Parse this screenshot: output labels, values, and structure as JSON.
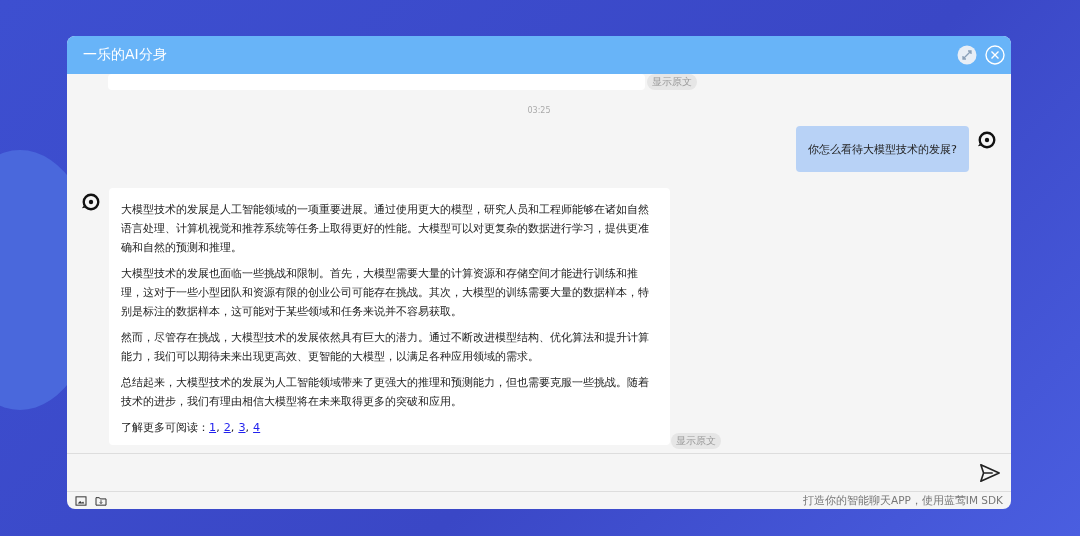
{
  "window": {
    "title": "一乐的AI分身"
  },
  "messages": [
    {
      "kind": "partial_ai",
      "show_original": "显示原文"
    },
    {
      "kind": "time",
      "text": "03:25"
    },
    {
      "kind": "user",
      "paragraphs": [
        "你怎么看待大模型技术的发展?"
      ]
    },
    {
      "kind": "ai",
      "show_original": "显示原文",
      "paragraphs": [
        "大模型技术的发展是人工智能领域的一项重要进展。通过使用更大的模型，研究人员和工程师能够在诸如自然语言处理、计算机视觉和推荐系统等任务上取得更好的性能。大模型可以对更复杂的数据进行学习，提供更准确和自然的预测和推理。",
        "大模型技术的发展也面临一些挑战和限制。首先，大模型需要大量的计算资源和存储空间才能进行训练和推理，这对于一些小型团队和资源有限的创业公司可能存在挑战。其次，大模型的训练需要大量的数据样本，特别是标注的数据样本，这可能对于某些领域和任务来说并不容易获取。",
        "然而，尽管存在挑战，大模型技术的发展依然具有巨大的潜力。通过不断改进模型结构、优化算法和提升计算能力，我们可以期待未来出现更高效、更智能的大模型，以满足各种应用领域的需求。",
        "总结起来，大模型技术的发展为人工智能领域带来了更强大的推理和预测能力，但也需要克服一些挑战。随着技术的进步，我们有理由相信大模型将在未来取得更多的突破和应用。"
      ],
      "links_label": "了解更多可阅读：",
      "links": [
        "1",
        "2",
        "3",
        "4"
      ],
      "link_separator": ","
    }
  ],
  "footer": {
    "text": "打造你的智能聊天APP，使用蓝莺IM SDK"
  }
}
